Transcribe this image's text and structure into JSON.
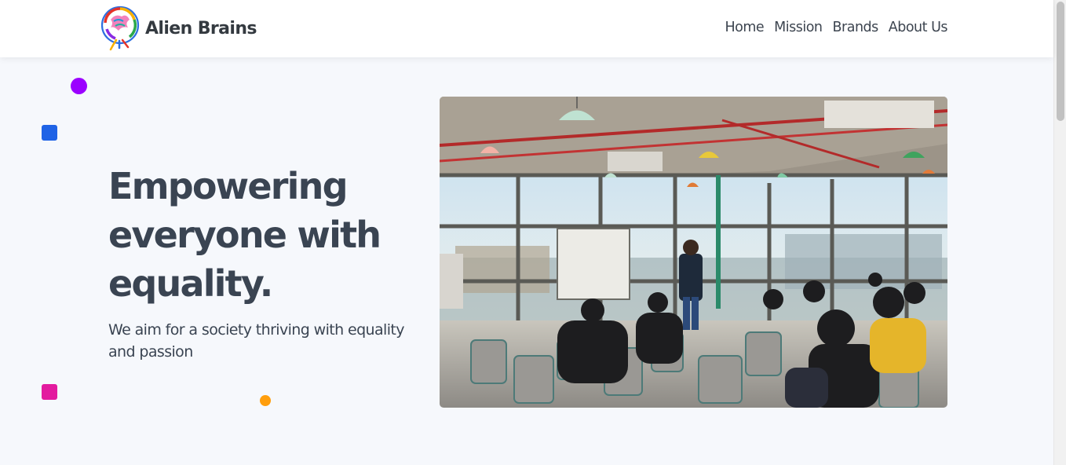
{
  "brand": {
    "name": "Alien Brains",
    "logo_icon": "colorful-brain-logo-icon"
  },
  "nav": {
    "home": "Home",
    "mission": "Mission",
    "brands": "Brands",
    "about": "About Us"
  },
  "hero": {
    "title": "Empowering everyone with equality.",
    "subtitle": "We aim for a society thriving with equality and passion",
    "image": "classroom-presentation-photo"
  },
  "colors": {
    "heading": "#3a4452",
    "background": "#f6f8fc",
    "dot_purple": "#9b00ff",
    "square_blue": "#1f63e6",
    "square_pink": "#e31b9f",
    "dot_orange": "#ff9e0d"
  }
}
